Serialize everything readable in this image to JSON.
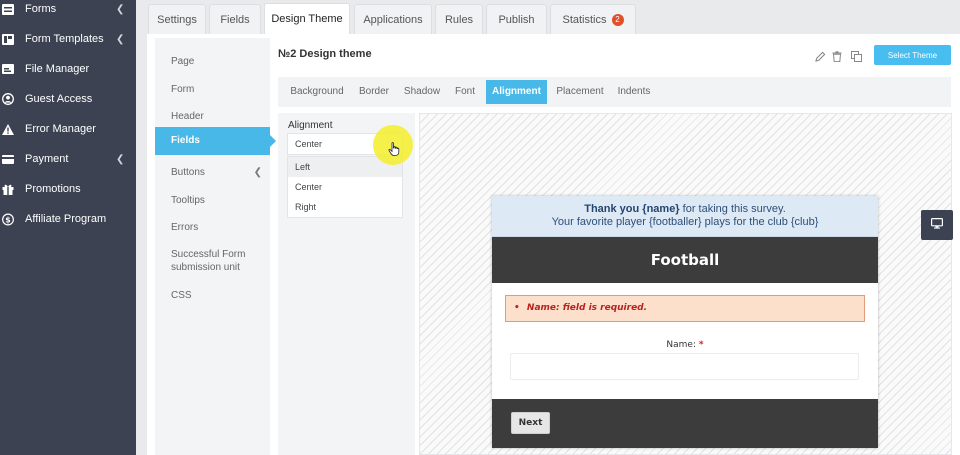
{
  "sidebar": {
    "items": [
      {
        "label": "Forms",
        "icon": "forms-icon",
        "has_submenu": true
      },
      {
        "label": "Form Templates",
        "icon": "form-templates-icon",
        "has_submenu": true
      },
      {
        "label": "File Manager",
        "icon": "file-manager-icon",
        "has_submenu": false
      },
      {
        "label": "Guest Access",
        "icon": "guest-access-icon",
        "has_submenu": false
      },
      {
        "label": "Error Manager",
        "icon": "warning-icon",
        "has_submenu": false
      },
      {
        "label": "Payment",
        "icon": "payment-card-icon",
        "has_submenu": true
      },
      {
        "label": "Promotions",
        "icon": "gift-icon",
        "has_submenu": false
      },
      {
        "label": "Affiliate Program",
        "icon": "dollar-icon",
        "has_submenu": false
      }
    ]
  },
  "tabs": [
    {
      "label": "Settings"
    },
    {
      "label": "Fields"
    },
    {
      "label": "Design Theme",
      "active": true
    },
    {
      "label": "Applications"
    },
    {
      "label": "Rules"
    },
    {
      "label": "Publish"
    },
    {
      "label": "Statistics",
      "badge": "2"
    }
  ],
  "left_nav": {
    "items": [
      {
        "label": "Page"
      },
      {
        "label": "Form"
      },
      {
        "label": "Header"
      },
      {
        "label": "Fields",
        "active": true
      },
      {
        "label": "Buttons",
        "has_submenu": true
      },
      {
        "label": "Tooltips"
      },
      {
        "label": "Errors"
      },
      {
        "label": "Successful Form",
        "label2": "submission unit"
      },
      {
        "label": "CSS"
      }
    ]
  },
  "theme": {
    "title": "№2 Design theme",
    "select_button": "Select Theme"
  },
  "subtabs": [
    {
      "label": "Background"
    },
    {
      "label": "Border"
    },
    {
      "label": "Shadow"
    },
    {
      "label": "Font"
    },
    {
      "label": "Alignment",
      "active": true
    },
    {
      "label": "Placement"
    },
    {
      "label": "Indents"
    }
  ],
  "alignment": {
    "label": "Alignment",
    "selected": "Center",
    "options": [
      "Left",
      "Center",
      "Right"
    ],
    "highlighted_index": 0
  },
  "preview": {
    "thanks_bold": "Thank you {name}",
    "thanks_rest": " for taking this survey.",
    "thanks_line2": "Your favorite player {footballer} plays for the club {club}",
    "form_title": "Football",
    "error": "Name: field is required.",
    "error_bullet": "•",
    "name_label": "Name:",
    "required_mark": "*",
    "next_button": "Next"
  },
  "colors": {
    "sidebar_bg": "#3c4252",
    "accent": "#47b8e8",
    "badge": "#e2502a",
    "form_dark": "#3c3c3c",
    "error_bg": "#fde0cc"
  }
}
